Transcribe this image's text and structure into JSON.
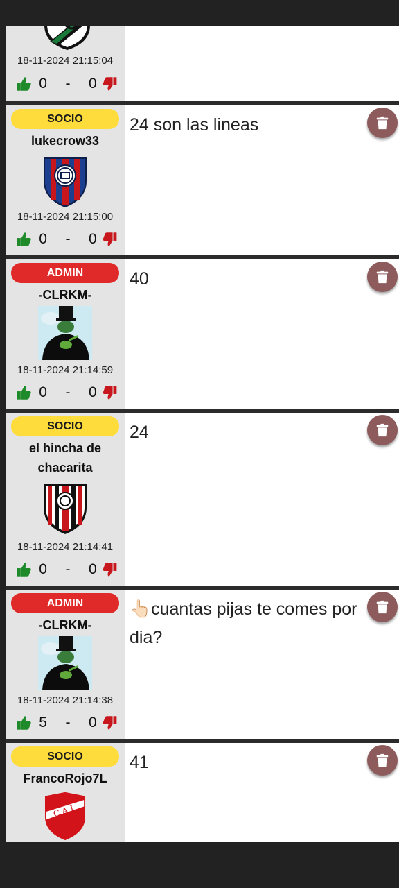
{
  "posts": [
    {
      "role": "",
      "username": "",
      "date": "18-11-2024 21:15:04",
      "likes": "0",
      "dislikes": "0",
      "message": "",
      "avatar": "club-badge-white-black"
    },
    {
      "role": "SOCIO",
      "username": "lukecrow33",
      "date": "18-11-2024 21:15:00",
      "likes": "0",
      "dislikes": "0",
      "message": "24 son las lineas",
      "avatar": "san-lorenzo-badge"
    },
    {
      "role": "ADMIN",
      "username": "-CLRKM-",
      "date": "18-11-2024 21:14:59",
      "likes": "0",
      "dislikes": "0",
      "message": "40",
      "avatar": "top-hat-frog-avatar"
    },
    {
      "role": "SOCIO",
      "username": "el hincha de chacarita",
      "date": "18-11-2024 21:14:41",
      "likes": "0",
      "dislikes": "0",
      "message": "24",
      "avatar": "chacarita-badge"
    },
    {
      "role": "ADMIN",
      "username": "-CLRKM-",
      "date": "18-11-2024 21:14:38",
      "likes": "5",
      "dislikes": "0",
      "message": "👆🏻cuantas pijas te comes por dia?",
      "avatar": "top-hat-frog-avatar"
    },
    {
      "role": "SOCIO",
      "username": "FrancoRojo7L",
      "date": "",
      "likes": "",
      "dislikes": "",
      "message": "41",
      "avatar": "independiente-badge"
    }
  ],
  "vote_separator": "-",
  "icons": {
    "like": "thumbs-up-icon",
    "dislike": "thumbs-down-icon",
    "delete": "trash-icon"
  },
  "colors": {
    "socio_badge": "#fddc3c",
    "admin_badge": "#e02a2a",
    "like": "#1f8a2a",
    "dislike": "#c8171c",
    "delete_button": "#8d5b5b"
  }
}
